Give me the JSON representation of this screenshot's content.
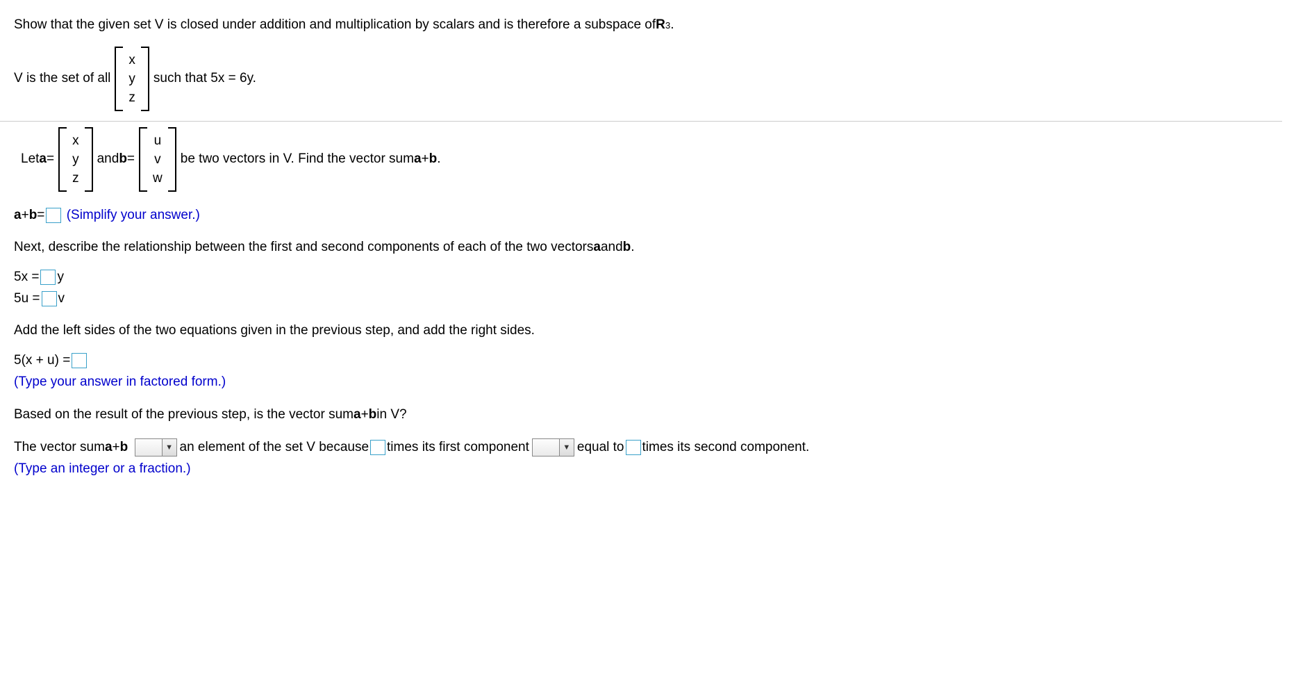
{
  "q1": {
    "prefix": "Show that the given set V is closed under addition and multiplication by scalars and is therefore a subspace of ",
    "space": "R",
    "exp": "3",
    "period": "."
  },
  "def": {
    "pre": "V is the set of all",
    "v1": "x",
    "v2": "y",
    "v3": "z",
    "post": "such that 5x = 6y."
  },
  "let": {
    "pre": "Let ",
    "a": "a",
    "eq1": " = ",
    "a1": "x",
    "a2": "y",
    "a3": "z",
    "mid": " and ",
    "b": "b",
    "eq2": " = ",
    "b1": "u",
    "b2": "v",
    "b3": "w",
    "post_pre": " be two vectors in V. Find the vector sum ",
    "expr_a": "a",
    "plus": " + ",
    "expr_b": "b",
    "period": "."
  },
  "sum": {
    "lhs_a": "a",
    "plus": " + ",
    "lhs_b": "b",
    "eq": " = ",
    "hint": "(Simplify your answer.)"
  },
  "rel": {
    "text_pre": "Next, describe the relationship between the first and second components of each of the two vectors ",
    "a": "a",
    "and": " and ",
    "b": "b",
    "period": "."
  },
  "eq1": {
    "lhs": "5x = ",
    "rhs": "y"
  },
  "eq2": {
    "lhs": "5u = ",
    "rhs": "v"
  },
  "add": {
    "text": "Add the left sides of the two equations given in the previous step, and add the right sides."
  },
  "factored": {
    "lhs": "5(x + u) = ",
    "hint": "(Type your answer in factored form.)"
  },
  "based": {
    "pre": "Based on the result of the previous step, is the vector sum ",
    "a": "a",
    "plus": " + ",
    "b": "b",
    "post": " in V?"
  },
  "final": {
    "pre": "The vector sum ",
    "a": "a",
    "plus": " + ",
    "b": "b",
    "mid1": " an element of the set V because ",
    "mid2": " times its first component ",
    "mid3": " equal to ",
    "mid4": " times its second component.",
    "hint": "(Type an integer or a fraction.)"
  },
  "dd_arrow": "▼"
}
